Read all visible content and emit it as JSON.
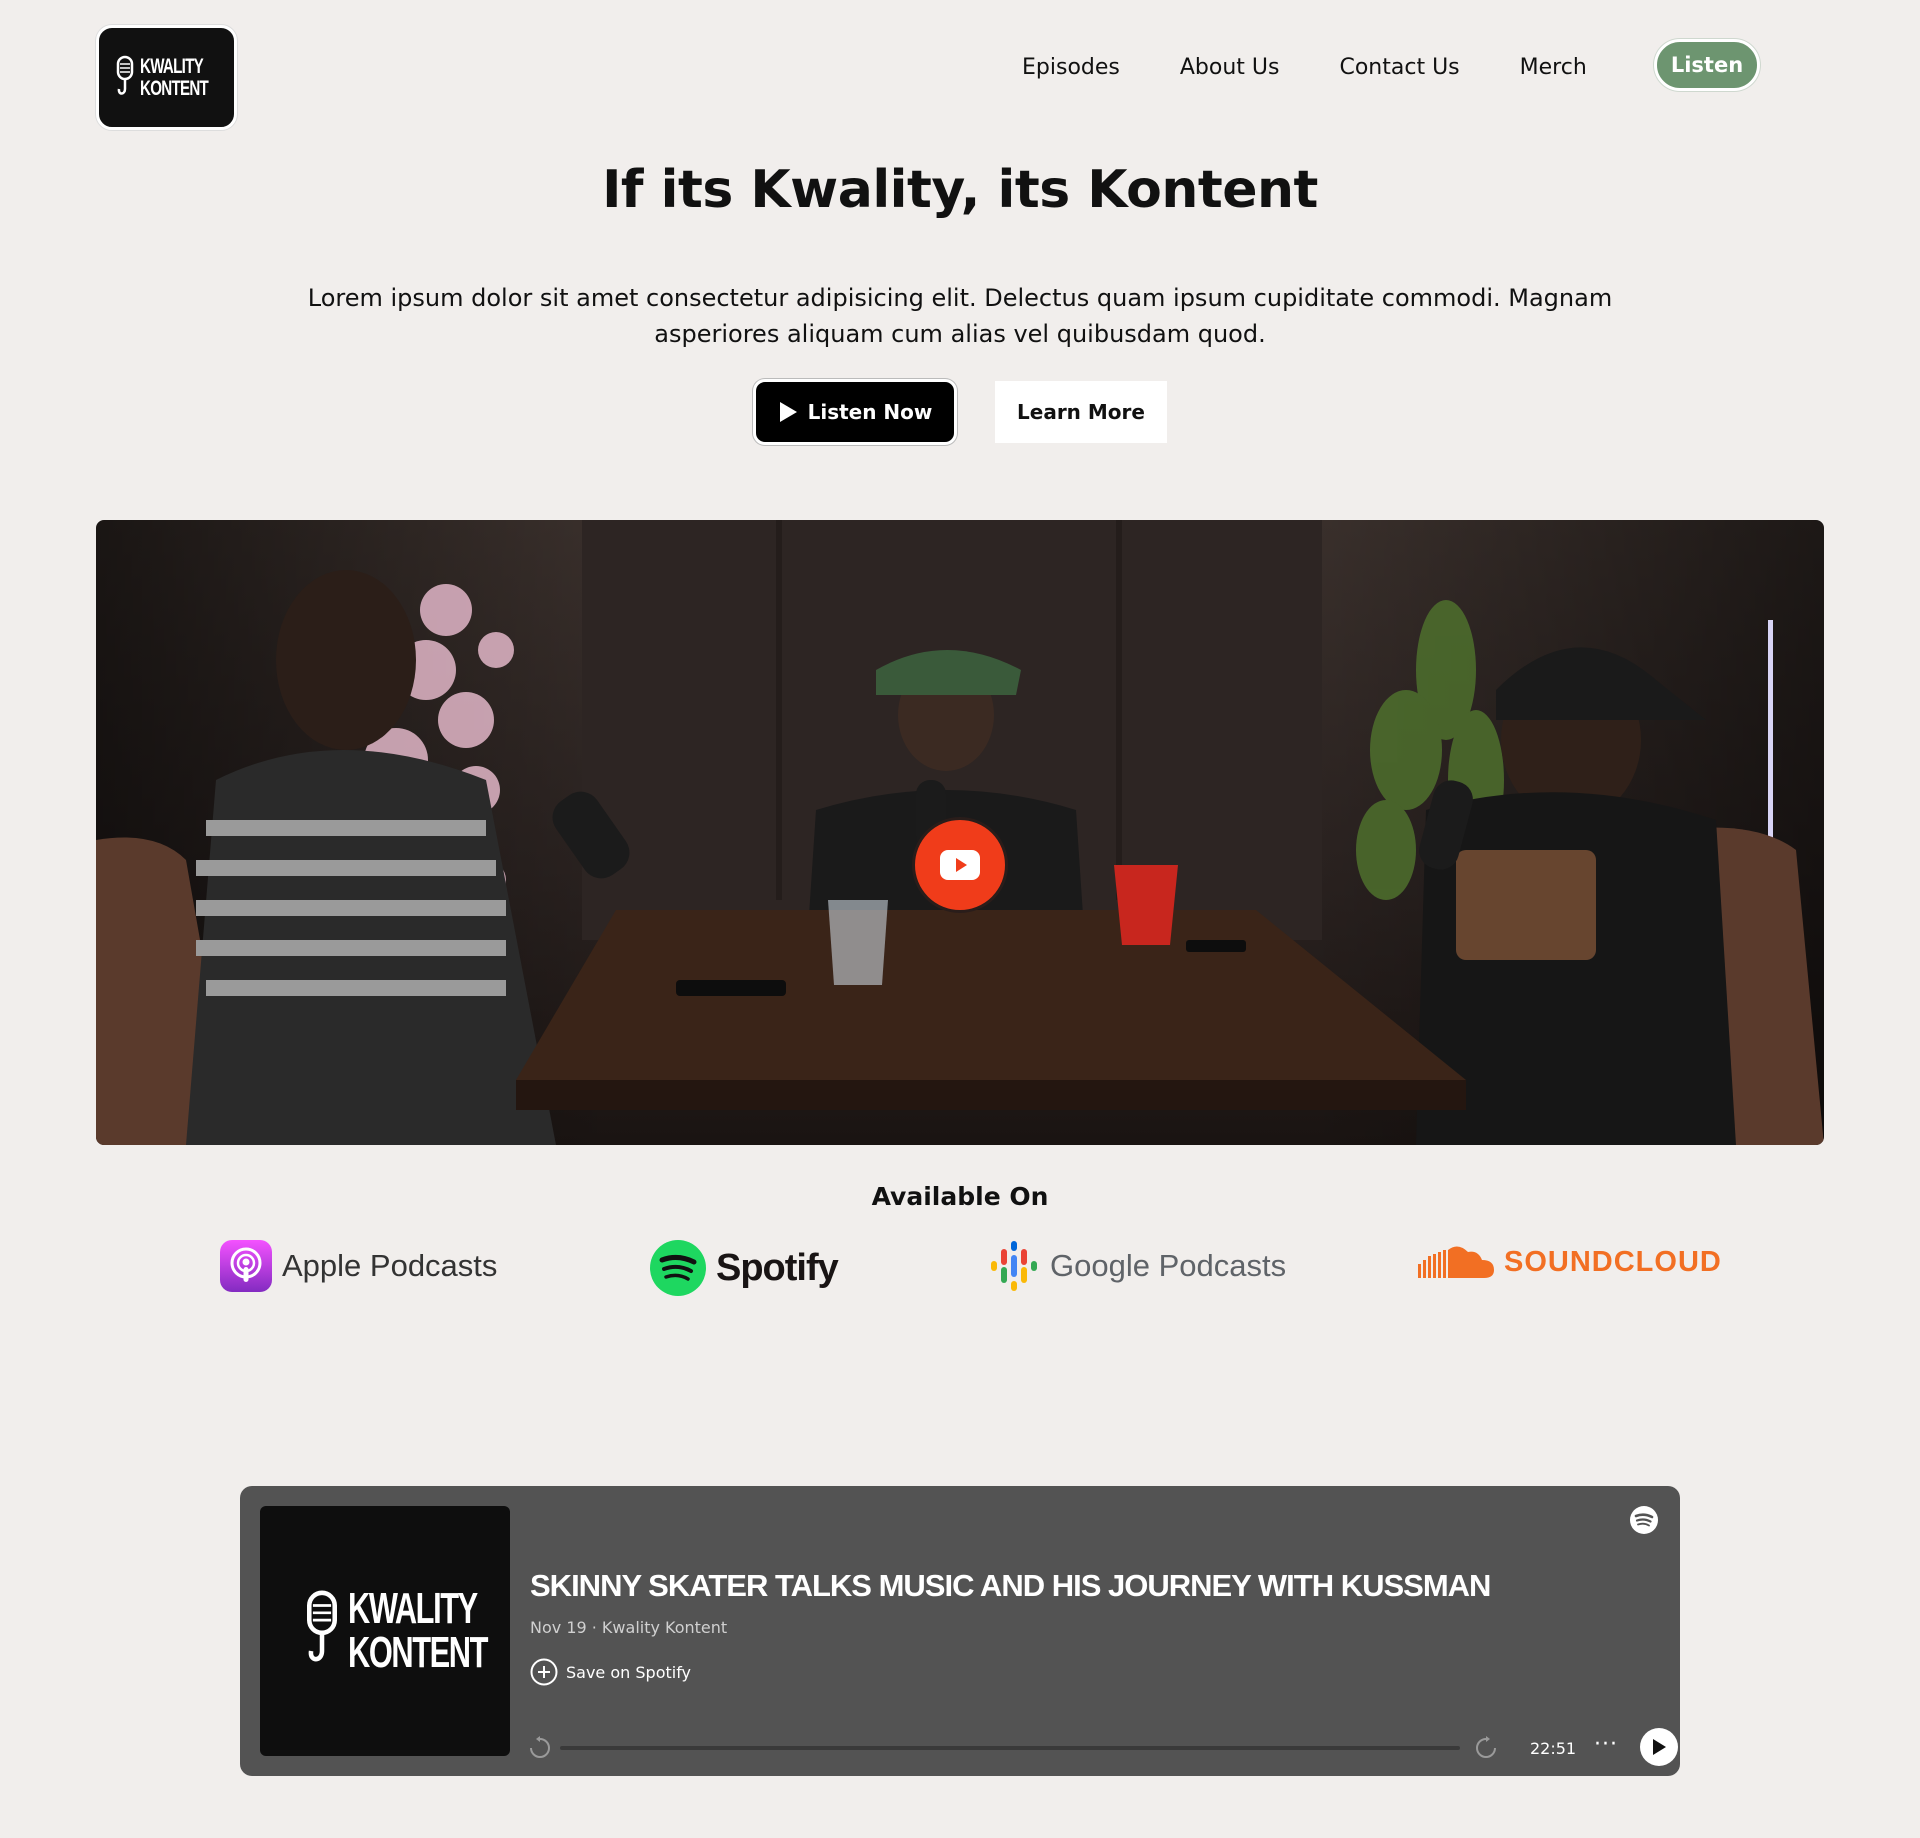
{
  "header": {
    "logo_text_line1": "KWALITY",
    "logo_text_line2": "KONTENT",
    "nav": [
      "Episodes",
      "About Us",
      "Contact Us",
      "Merch"
    ],
    "listen_label": "Listen",
    "listen_color": "#6d9570"
  },
  "hero": {
    "title": "If its Kwality, its Kontent",
    "description": "Lorem ipsum dolor sit amet consectetur adipisicing elit. Delectus quam ipsum cupiditate commodi. Magnam asperiores aliquam cum alias vel quibusdam quod.",
    "listen_now_label": "Listen Now",
    "learn_more_label": "Learn More"
  },
  "video": {
    "play_icon": "youtube-play-icon",
    "play_color": "#f03c1a"
  },
  "available": {
    "title": "Available On",
    "platforms": [
      {
        "name": "Apple Podcasts",
        "icon": "apple-podcasts-icon",
        "color": "#a94fe3"
      },
      {
        "name": "Spotify",
        "icon": "spotify-icon",
        "color": "#1ed760"
      },
      {
        "name": "Google Podcasts",
        "icon": "google-podcasts-icon",
        "color": "#4285f4"
      },
      {
        "name": "SOUNDCLOUD",
        "icon": "soundcloud-icon",
        "color": "#f26f23"
      }
    ]
  },
  "embed": {
    "cover_line1": "KWALITY",
    "cover_line2": "KONTENT",
    "episode_title": "SKINNY SKATER TALKS MUSIC AND HIS JOURNEY WITH KUSSMAN",
    "meta": "Nov 19 · Kwality Kontent",
    "save_label": "Save on Spotify",
    "duration": "22:51",
    "more_label": "···",
    "background": "#535353"
  }
}
